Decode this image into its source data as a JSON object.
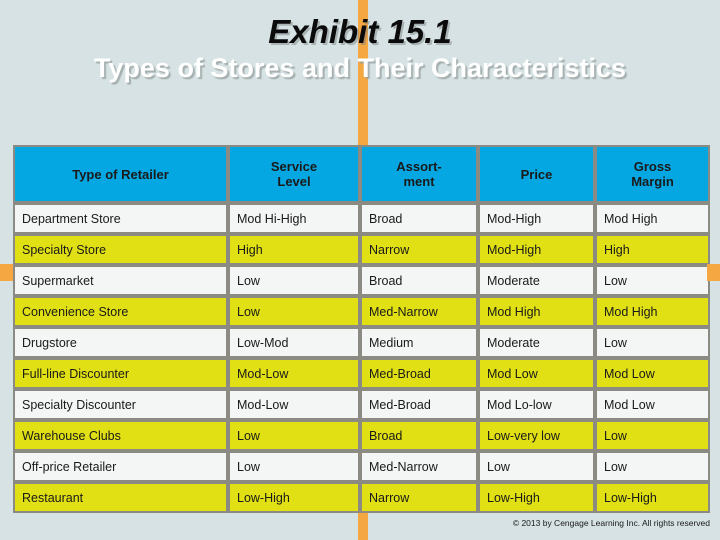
{
  "slide": {
    "title": "Exhibit 15.1",
    "subtitle": "Types of Stores and Their Characteristics",
    "footer": "© 2013 by Cengage Learning Inc.  All rights reserved",
    "colors": {
      "background": "#d6e2e3",
      "accent_orange": "#f5a742",
      "header_blue": "#05a7e3",
      "row_yellow": "#e0e014",
      "row_white": "#f4f5f5",
      "border_gray": "#8b8b84"
    }
  },
  "table": {
    "columns": [
      "Type of Retailer",
      "Service\nLevel",
      "Assort-\nment",
      "Price",
      "Gross\nMargin"
    ],
    "columns_display": [
      {
        "line1": "Type of Retailer",
        "line2": ""
      },
      {
        "line1": "Service",
        "line2": "Level"
      },
      {
        "line1": "Assort-",
        "line2": "ment"
      },
      {
        "line1": "Price",
        "line2": ""
      },
      {
        "line1": "Gross",
        "line2": "Margin"
      }
    ],
    "rows": [
      {
        "shade": "white",
        "retailer": "Department Store",
        "service_level": "Mod Hi-High",
        "assortment": "Broad",
        "price": "Mod-High",
        "gross_margin": "Mod High"
      },
      {
        "shade": "yellow",
        "retailer": "Specialty Store",
        "service_level": "High",
        "assortment": "Narrow",
        "price": "Mod-High",
        "gross_margin": "High"
      },
      {
        "shade": "white",
        "retailer": "Supermarket",
        "service_level": "Low",
        "assortment": "Broad",
        "price": "Moderate",
        "gross_margin": "Low"
      },
      {
        "shade": "yellow",
        "retailer": "Convenience Store",
        "service_level": "Low",
        "assortment": "Med-Narrow",
        "price": "Mod High",
        "gross_margin": "Mod High"
      },
      {
        "shade": "white",
        "retailer": "Drugstore",
        "service_level": "Low-Mod",
        "assortment": "Medium",
        "price": "Moderate",
        "gross_margin": "Low"
      },
      {
        "shade": "yellow",
        "retailer": "Full-line Discounter",
        "service_level": "Mod-Low",
        "assortment": "Med-Broad",
        "price": "Mod Low",
        "gross_margin": "Mod Low"
      },
      {
        "shade": "white",
        "retailer": "Specialty Discounter",
        "service_level": "Mod-Low",
        "assortment": "Med-Broad",
        "price": "Mod Lo-low",
        "gross_margin": "Mod Low"
      },
      {
        "shade": "yellow",
        "retailer": "Warehouse Clubs",
        "service_level": "Low",
        "assortment": "Broad",
        "price": "Low-very low",
        "price_small": true,
        "gross_margin": "Low"
      },
      {
        "shade": "white",
        "retailer": "Off-price Retailer",
        "service_level": "Low",
        "assortment": "Med-Narrow",
        "price": "Low",
        "gross_margin": "Low"
      },
      {
        "shade": "yellow",
        "retailer": "Restaurant",
        "service_level": "Low-High",
        "assortment": "Narrow",
        "price": "Low-High",
        "gross_margin": "Low-High"
      }
    ]
  }
}
